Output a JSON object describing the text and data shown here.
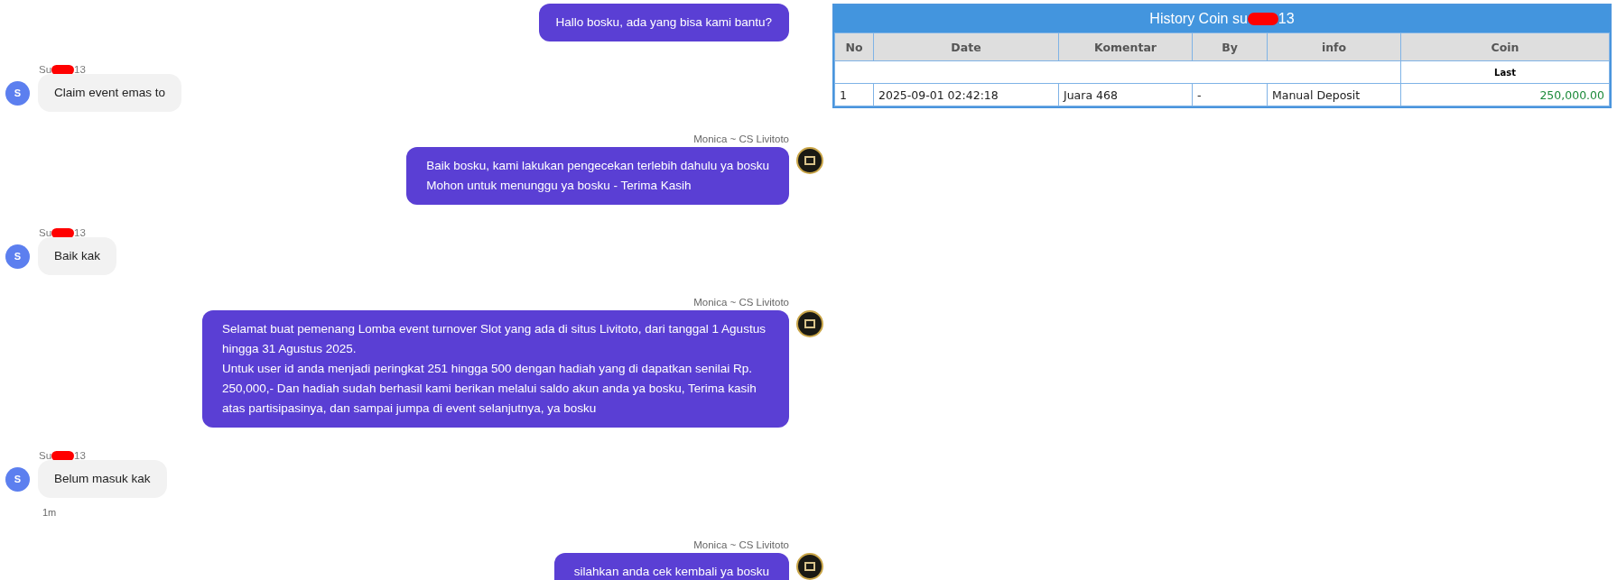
{
  "chat": {
    "messages": [
      {
        "kind": "outgoing",
        "text": "Hallo bosku, ada yang bisa kami bantu?"
      },
      {
        "kind": "incoming",
        "sender": {
          "prefix": "Su",
          "suffix": "13"
        },
        "avatar": "S",
        "text": "Claim event emas to"
      },
      {
        "kind": "outgoing",
        "agent": "Monica ~ CS Livitoto",
        "avatar": true,
        "text": "Baik bosku, kami lakukan pengecekan terlebih dahulu ya bosku\nMohon untuk menunggu ya bosku - Terima Kasih"
      },
      {
        "kind": "incoming",
        "sender": {
          "prefix": "Su",
          "suffix": "13"
        },
        "avatar": "S",
        "text": "Baik kak"
      },
      {
        "kind": "outgoing",
        "agent": "Monica ~ CS Livitoto",
        "avatar": true,
        "text": "Selamat buat pemenang Lomba event turnover Slot yang ada di situs Livitoto, dari tanggal 1 Agustus hingga 31 Agustus 2025.\nUntuk user id anda menjadi peringkat 251 hingga 500 dengan hadiah yang di dapatkan senilai Rp. 250,000,- Dan hadiah sudah berhasil kami berikan melalui saldo akun anda ya bosku, Terima kasih atas partisipasinya, dan sampai jumpa di event selanjutnya, ya bosku"
      },
      {
        "kind": "incoming",
        "sender": {
          "prefix": "Su",
          "suffix": "13"
        },
        "avatar": "S",
        "text": "Belum masuk kak",
        "time": "1m"
      },
      {
        "kind": "outgoing",
        "agent": "Monica ~ CS Livitoto",
        "avatar": true,
        "text": "silahkan anda cek kembali ya bosku"
      }
    ]
  },
  "history_table": {
    "title": {
      "prefix": "History Coin su",
      "suffix": "13"
    },
    "columns": [
      "No",
      "Date",
      "Komentar",
      "By",
      "info",
      "Coin"
    ],
    "summary_row": {
      "label": "Last"
    },
    "rows": [
      [
        "1",
        "2025-09-01 02:42:18",
        "Juara 468",
        "-",
        "Manual Deposit",
        "250,000.00"
      ]
    ]
  }
}
